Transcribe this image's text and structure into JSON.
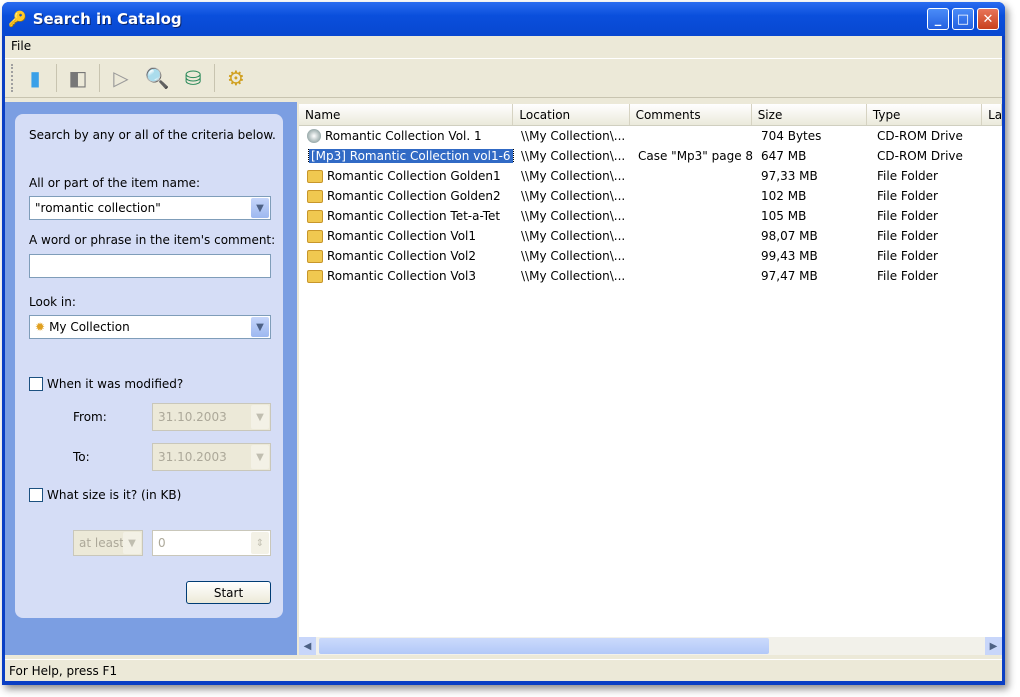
{
  "window": {
    "title": "Search in Catalog"
  },
  "menu": {
    "file": "File"
  },
  "toolbar": {
    "icons": [
      "new-icon",
      "open-icon",
      "play-icon",
      "search-icon",
      "catalog-icon",
      "settings-icon"
    ]
  },
  "search": {
    "intro": "Search by any or all of the criteria below.",
    "name_label": "All or part of the item name:",
    "name_value": "\"romantic collection\"",
    "comment_label": "A word or phrase in the item's comment:",
    "comment_value": "",
    "lookin_label": "Look in:",
    "lookin_value": "My Collection",
    "modified_label": "When it was modified?",
    "from_label": "From:",
    "from_value": "31.10.2003",
    "to_label": "To:",
    "to_value": "31.10.2003",
    "size_label": "What size is it? (in KB)",
    "size_mode": "at least",
    "size_value": "0",
    "start": "Start"
  },
  "list": {
    "columns": [
      "Name",
      "Location",
      "Comments",
      "Size",
      "Type",
      "La"
    ],
    "rows": [
      {
        "name": "Romantic Collection Vol. 1",
        "location": "\\\\My Collection\\...",
        "comments": "",
        "size": "704 Bytes",
        "type": "CD-ROM Drive",
        "icon": "cd"
      },
      {
        "name": "[Mp3] Romantic Collection vol1-6",
        "location": "\\\\My Collection\\...",
        "comments": "Case \"Mp3\" page  8",
        "size": "647 MB",
        "type": "CD-ROM Drive",
        "icon": "cd"
      },
      {
        "name": "Romantic Collection Golden1",
        "location": "\\\\My Collection\\...",
        "comments": "",
        "size": "97,33 MB",
        "type": "File Folder",
        "icon": "folder"
      },
      {
        "name": "Romantic Collection Golden2",
        "location": "\\\\My Collection\\...",
        "comments": "",
        "size": "102 MB",
        "type": "File Folder",
        "icon": "folder"
      },
      {
        "name": "Romantic Collection Tet-a-Tet",
        "location": "\\\\My Collection\\...",
        "comments": "",
        "size": "105 MB",
        "type": "File Folder",
        "icon": "folder"
      },
      {
        "name": "Romantic Collection Vol1",
        "location": "\\\\My Collection\\...",
        "comments": "",
        "size": "98,07 MB",
        "type": "File Folder",
        "icon": "folder"
      },
      {
        "name": "Romantic Collection Vol2",
        "location": "\\\\My Collection\\...",
        "comments": "",
        "size": "99,43 MB",
        "type": "File Folder",
        "icon": "folder"
      },
      {
        "name": "Romantic Collection Vol3",
        "location": "\\\\My Collection\\...",
        "comments": "",
        "size": "97,47 MB",
        "type": "File Folder",
        "icon": "folder"
      }
    ]
  },
  "status": {
    "text": "For Help, press F1"
  }
}
